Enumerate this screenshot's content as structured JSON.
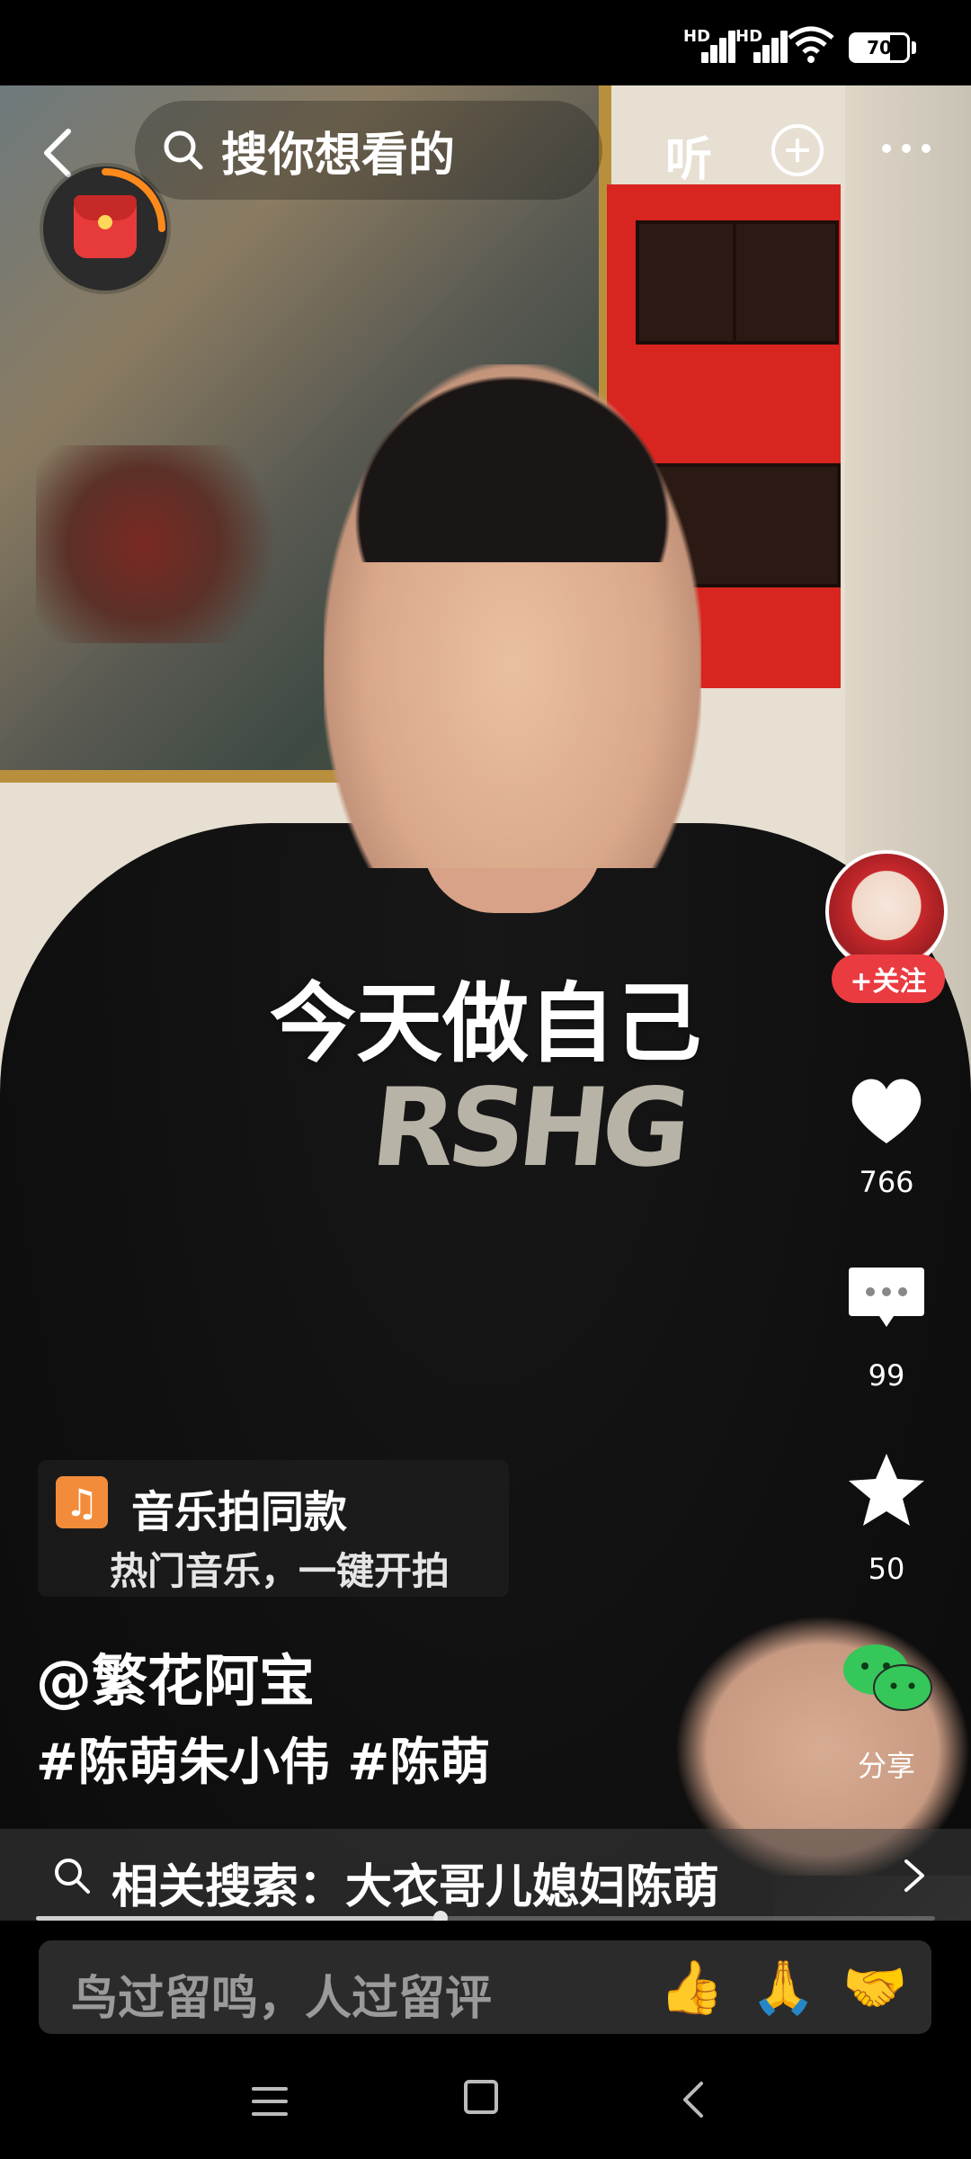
{
  "status_bar": {
    "signal1_label": "HD",
    "signal2_label": "HD",
    "battery_level": 70,
    "battery_text": "70"
  },
  "top_bar": {
    "search_placeholder": "搜你想看的",
    "listen_label": "听",
    "icons": [
      "back-icon",
      "search-icon",
      "add-icon",
      "more-icon"
    ]
  },
  "video": {
    "overlay_text": "今天做自己",
    "shirt_text": "RSHG"
  },
  "right_rail": {
    "follow_label": "+关注",
    "likes": "766",
    "comments": "99",
    "favorites": "50",
    "share_label": "分享"
  },
  "music_card": {
    "title": "音乐拍同款",
    "subtitle": "热门音乐，一键开拍"
  },
  "post": {
    "author": "@繁花阿宝",
    "tags": "#陈萌朱小伟 #陈萌"
  },
  "related_search": {
    "text": "相关搜索：大衣哥儿媳妇陈萌"
  },
  "playback": {
    "progress": 0.45
  },
  "comment_bar": {
    "placeholder": "鸟过留鸣，人过留评",
    "emojis": [
      "👍",
      "🙏",
      "🤝"
    ]
  },
  "colors": {
    "accent": "#ea3b41",
    "music_icon": "#f28c3b",
    "share_green": "#35c759"
  }
}
